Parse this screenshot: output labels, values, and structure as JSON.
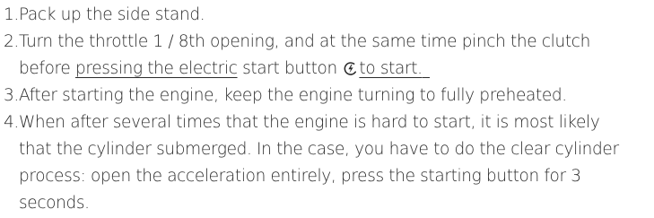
{
  "instructions": {
    "step1": "1.Pack up the side stand.",
    "step2": {
      "line1": "2.Turn the throttle 1 / 8th opening, and at the same time pinch the clutch",
      "before": "before ",
      "underlined1": "pressing the electric",
      "middle": " start button",
      "icon": "electric-start-icon",
      "underlined2": "to start."
    },
    "step3": "3.After starting the engine, keep the engine turning to fully preheated.",
    "step4": {
      "line1": "4.When after several times that the engine is hard to start, it is most likely",
      "line2": "that the cylinder submerged. In the case, you have to do the clear cylinder",
      "line3": "process: open the acceleration entirely, press the starting button for 3",
      "line4": "seconds."
    }
  }
}
